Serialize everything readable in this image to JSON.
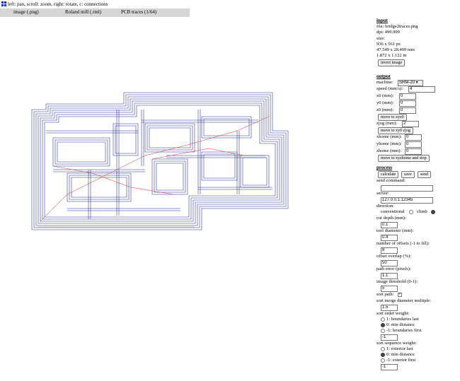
{
  "hint": "left: pan, scroll: zoom, right: rotate, c: connections",
  "tabs": [
    "image (.png)",
    "Roland mill (.rml)",
    "PCB traces (1/64)"
  ],
  "input": {
    "header": "input",
    "file": "file: bridge2traces.png",
    "dpi": "dpi: 499.999",
    "size_label": "size:",
    "size_px": "936 x 561 px",
    "size_mm": "47.549 x 28.499 mm",
    "size_in": "1.872 x 1.122 in",
    "invert_label": "invert image"
  },
  "output": {
    "header": "output",
    "machine_label": "machine:",
    "machine_value": "SRM-20 ▾",
    "speed_label": "speed (mm/s):",
    "speed_value": "4",
    "x0_label": "x0 (mm):",
    "x0_value": "0",
    "y0_label": "y0 (mm):",
    "y0_value": "0",
    "z0_label": "z0 (mm):",
    "z0_value": "0",
    "move_xyz0_label": "move to xyz0",
    "zjog_label": "zjog (mm):",
    "zjog_value": "2",
    "move_xy0zjog_label": "move to xy0 zjog",
    "xhome_label": "xhome (mm):",
    "xhome_value": "0",
    "yhome_label": "yhome (mm):",
    "yhome_value": "0",
    "zhome_label": "zhome (mm):",
    "zhome_value": "0",
    "move_home_label": "move to xyzhome and stop"
  },
  "process": {
    "header": "process",
    "calculate_label": "calculate",
    "save_label": "save",
    "send_label": "send",
    "send_command_label": "send command:",
    "send_command_value": "",
    "server_label": "server:",
    "server_value": "127.0.0.1:12345",
    "direction_label": "direction:",
    "conventional_label": "conventional",
    "climb_label": "climb",
    "cut_depth_label": "cut depth (mm):",
    "cut_depth_value": "0.1",
    "tool_diameter_label": "tool diameter (mm):",
    "tool_diameter_value": "0.4",
    "offsets_label": "number of offsets (-1 to fill):",
    "offsets_value": "8",
    "overlap_label": "offset overlap (%):",
    "overlap_value": "50",
    "path_error_label": "path error (pixels):",
    "path_error_value": "1.1",
    "threshold_label": "image threshold (0-1):",
    "threshold_value": "5",
    "sort_path_label": "sort path:",
    "merge_label": "sort merge diameter multiple:",
    "merge_value": "1.5",
    "order_weight_label": "sort order weight:",
    "order_opts": [
      "1: boundaries last",
      "0: min distance",
      "-1: boundaries first"
    ],
    "order_value": "-1",
    "sequence_weight_label": "sort sequence weight:",
    "sequence_opts": [
      "1: exterior last",
      "0: min distance",
      "-1: exterior first"
    ],
    "sequence_value": "-1"
  }
}
